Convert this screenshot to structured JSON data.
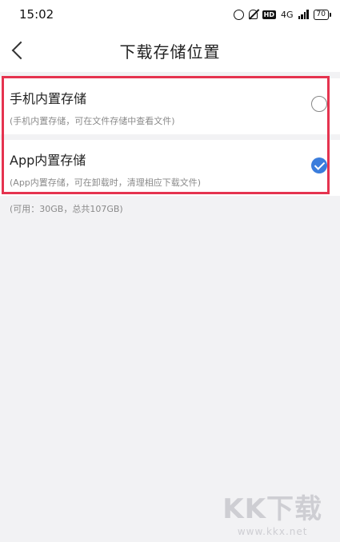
{
  "status_bar": {
    "time": "15:02",
    "network": "4G",
    "battery": "70"
  },
  "header": {
    "title": "下载存储位置"
  },
  "options": [
    {
      "title": "手机内置存储",
      "description": "(手机内置存储，可在文件存储中查看文件)",
      "selected": false
    },
    {
      "title": "App内置存储",
      "description": "(App内置存储，可在卸载时，清理相应下载文件)",
      "selected": true
    }
  ],
  "storage_info": "(可用：30GB，总共107GB)",
  "watermark": {
    "logo": "KK下载",
    "url": "www.kkx.net"
  },
  "colors": {
    "accent": "#3b7ddc",
    "highlight": "#e5334f"
  }
}
